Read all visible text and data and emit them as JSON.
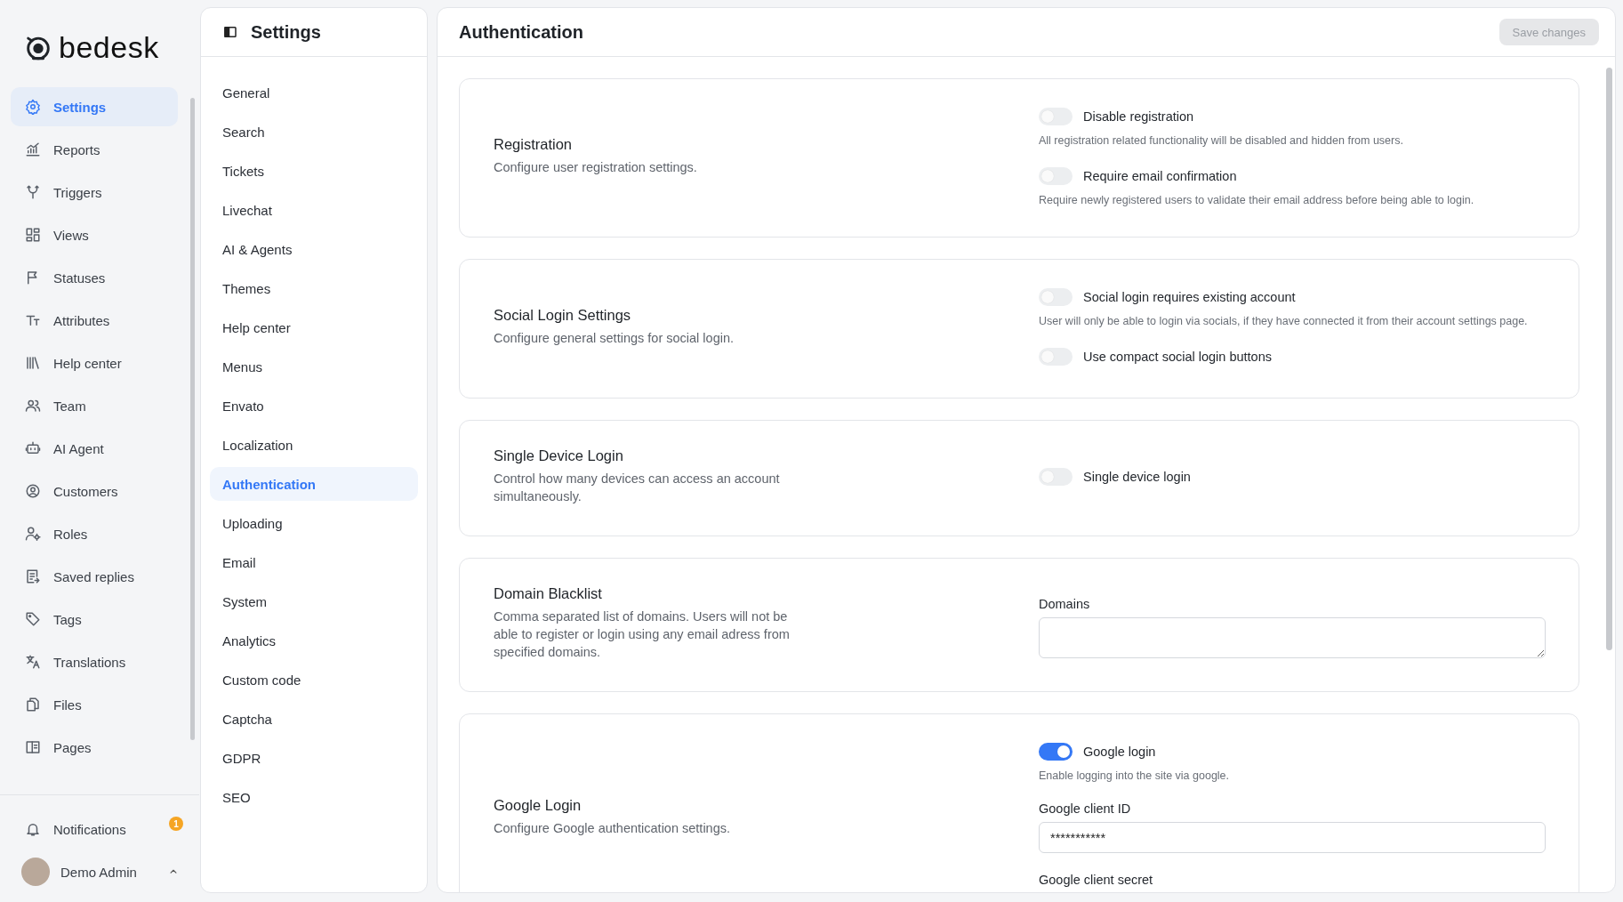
{
  "sidebar": {
    "logo": "bedesk",
    "items": [
      {
        "label": "Settings",
        "selected": true
      },
      {
        "label": "Reports",
        "selected": false
      },
      {
        "label": "Triggers",
        "selected": false
      },
      {
        "label": "Views",
        "selected": false
      },
      {
        "label": "Statuses",
        "selected": false
      },
      {
        "label": "Attributes",
        "selected": false
      },
      {
        "label": "Help center",
        "selected": false
      },
      {
        "label": "Team",
        "selected": false
      },
      {
        "label": "AI Agent",
        "selected": false
      },
      {
        "label": "Customers",
        "selected": false
      },
      {
        "label": "Roles",
        "selected": false
      },
      {
        "label": "Saved replies",
        "selected": false
      },
      {
        "label": "Tags",
        "selected": false
      },
      {
        "label": "Translations",
        "selected": false
      },
      {
        "label": "Files",
        "selected": false
      },
      {
        "label": "Pages",
        "selected": false
      }
    ],
    "notifications": {
      "label": "Notifications",
      "count": "1"
    },
    "user": {
      "name": "Demo Admin"
    }
  },
  "settings_nav": {
    "title": "Settings",
    "items": [
      {
        "label": "General",
        "selected": false
      },
      {
        "label": "Search",
        "selected": false
      },
      {
        "label": "Tickets",
        "selected": false
      },
      {
        "label": "Livechat",
        "selected": false
      },
      {
        "label": "AI & Agents",
        "selected": false
      },
      {
        "label": "Themes",
        "selected": false
      },
      {
        "label": "Help center",
        "selected": false
      },
      {
        "label": "Menus",
        "selected": false
      },
      {
        "label": "Envato",
        "selected": false
      },
      {
        "label": "Localization",
        "selected": false
      },
      {
        "label": "Authentication",
        "selected": true
      },
      {
        "label": "Uploading",
        "selected": false
      },
      {
        "label": "Email",
        "selected": false
      },
      {
        "label": "System",
        "selected": false
      },
      {
        "label": "Analytics",
        "selected": false
      },
      {
        "label": "Custom code",
        "selected": false
      },
      {
        "label": "Captcha",
        "selected": false
      },
      {
        "label": "GDPR",
        "selected": false
      },
      {
        "label": "SEO",
        "selected": false
      }
    ]
  },
  "main": {
    "title": "Authentication",
    "save_button": {
      "label": "Save changes",
      "disabled": true
    },
    "sections": [
      {
        "title": "Registration",
        "description": "Configure user registration settings.",
        "controls": [
          {
            "kind": "toggle",
            "label": "Disable registration",
            "on": false,
            "help": "All registration related functionality will be disabled and hidden from users."
          },
          {
            "kind": "toggle",
            "label": "Require email confirmation",
            "on": false,
            "help": "Require newly registered users to validate their email address before being able to login."
          }
        ]
      },
      {
        "title": "Social Login Settings",
        "description": "Configure general settings for social login.",
        "controls": [
          {
            "kind": "toggle",
            "label": "Social login requires existing account",
            "on": false,
            "help": "User will only be able to login via socials, if they have connected it from their account settings page."
          },
          {
            "kind": "toggle",
            "label": "Use compact social login buttons",
            "on": false
          }
        ]
      },
      {
        "title": "Single Device Login",
        "description": "Control how many devices can access an account simultaneously.",
        "controls": [
          {
            "kind": "toggle",
            "label": "Single device login",
            "on": false
          }
        ]
      },
      {
        "title": "Domain Blacklist",
        "description": "Comma separated list of domains. Users will not be able to register or login using any email adress from specified domains.",
        "controls": [
          {
            "kind": "textarea",
            "label": "Domains"
          }
        ]
      },
      {
        "title": "Google Login",
        "description": "Configure Google authentication settings.",
        "controls": [
          {
            "kind": "toggle",
            "label": "Google login",
            "on": true,
            "help": "Enable logging into the site via google."
          },
          {
            "kind": "input",
            "label": "Google client ID",
            "value": "***********"
          },
          {
            "kind": "field-label",
            "label": "Google client secret"
          }
        ]
      }
    ]
  }
}
